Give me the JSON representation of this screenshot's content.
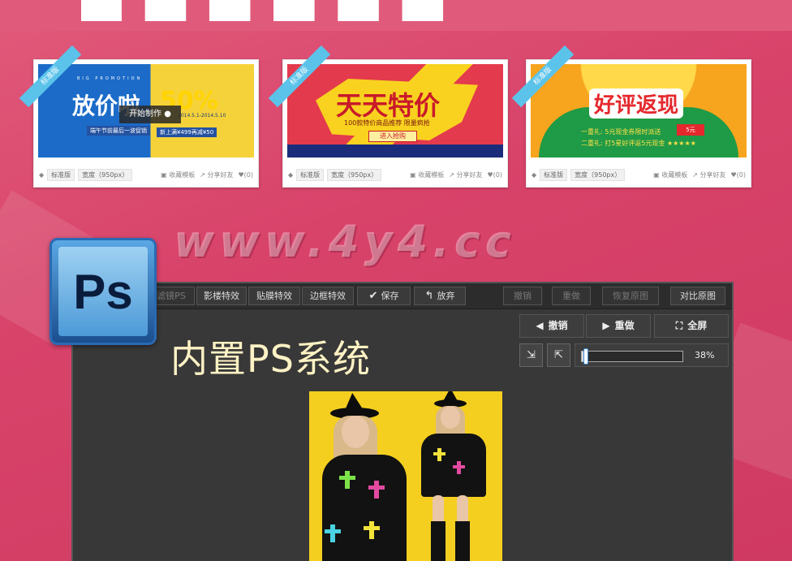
{
  "cards": [
    {
      "ribbon": "标准版",
      "thumb": {
        "sub": "BIG PROMOTION",
        "big": "放价啦",
        "pct": "50%",
        "line1": "端午节前最后一波促销",
        "line2": "新上满¥499再减¥50",
        "date": "2014.5.1-2014.5.10",
        "overlay": "开始制作"
      },
      "tag1": "标准版",
      "tag2": "宽度（950px）",
      "collect": "收藏模板",
      "share": "分享好友",
      "likes": "(0)"
    },
    {
      "ribbon": "标准版",
      "thumb": {
        "title": "天天特价",
        "sub": "100款特价商品推荐 限量疯抢",
        "btn": "进入抢购"
      },
      "tag1": "标准版",
      "tag2": "宽度（950px）",
      "collect": "收藏模板",
      "share": "分享好友",
      "likes": "(0)"
    },
    {
      "ribbon": "标准版",
      "thumb": {
        "title": "好评返现",
        "l1": "一重礼: 5元现金券限时派送",
        "l2": "二重礼: 打5星好评返5元现金 ★★★★★",
        "stamp": "5元"
      },
      "tag1": "标准版",
      "tag2": "宽度（950px）",
      "collect": "收藏模板",
      "share": "分享好友",
      "likes": "(0)"
    }
  ],
  "watermark": "www.4y4.cc",
  "ps_icon": {
    "label": "Ps",
    "icon": "photoshop-icon"
  },
  "toolbar": {
    "items": [
      "滤镜PS",
      "影楼特效",
      "贴膜特效",
      "边框特效",
      "保存",
      "放弃"
    ],
    "right_items": [
      "撤销",
      "重做",
      "恢复原图",
      "对比原图"
    ]
  },
  "side": {
    "undo": "撤销",
    "redo": "重做",
    "fullscreen": "全屏",
    "zoom": "38%",
    "zoom_value": 0.04
  },
  "heading": "内置PS系统",
  "colors": {
    "background": "#d8436a",
    "editor": "#383838",
    "heading": "#fff2c4",
    "photo_bg": "#f4cf1f"
  }
}
